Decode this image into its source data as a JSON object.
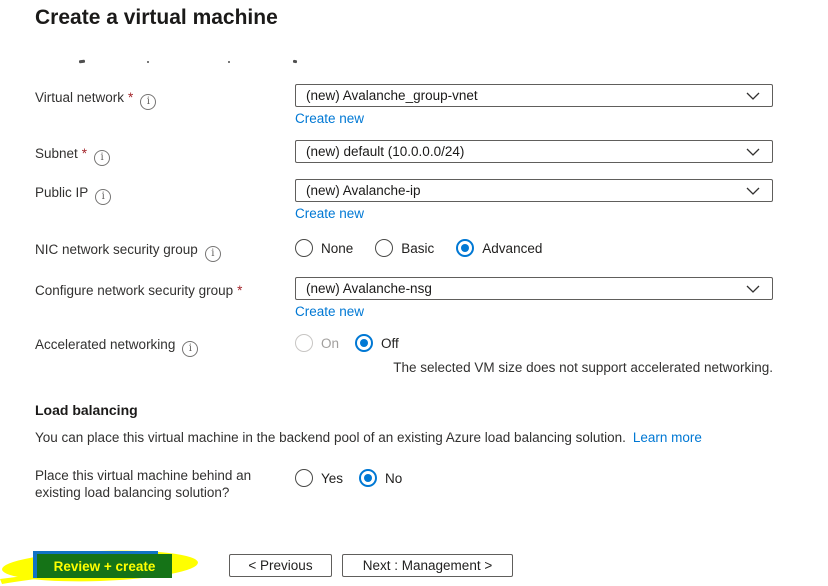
{
  "title": "Create a virtual machine",
  "icons": {
    "info": "i",
    "chevron": "chevron-down"
  },
  "colors": {
    "link": "#0078d4",
    "accent": "#0078d4",
    "required_asterisk": "#a4262c",
    "annotation_yellow": "#ffff00",
    "annotation_green": "#157317",
    "annotation_blue": "#1173c5"
  },
  "fields": {
    "virtual_network": {
      "label": "Virtual network",
      "required": "*",
      "value": "(new) Avalanche_group-vnet",
      "create_new": "Create new"
    },
    "subnet": {
      "label": "Subnet",
      "required": "*",
      "value": "(new) default (10.0.0.0/24)"
    },
    "public_ip": {
      "label": "Public IP",
      "value": "(new) Avalanche-ip",
      "create_new": "Create new"
    },
    "nic_nsg": {
      "label": "NIC network security group",
      "options": [
        "None",
        "Basic",
        "Advanced"
      ],
      "selected": "Advanced"
    },
    "configure_nsg": {
      "label": "Configure network security group",
      "required": "*",
      "value": "(new) Avalanche-nsg",
      "create_new": "Create new"
    },
    "accelerated_networking": {
      "label": "Accelerated networking",
      "options": [
        "On",
        "Off"
      ],
      "selected": "Off",
      "disabled_option": "On",
      "note": "The selected VM size does not support accelerated networking."
    }
  },
  "load_balancing": {
    "heading": "Load balancing",
    "description": "You can place this virtual machine in the backend pool of an existing Azure load balancing solution.",
    "learn_more": "Learn more",
    "question": {
      "line1": "Place this virtual machine behind an",
      "line2": "existing load balancing solution?",
      "options": [
        "Yes",
        "No"
      ],
      "selected": "No"
    }
  },
  "footer": {
    "review_create": "Review + create",
    "previous": "< Previous",
    "next": "Next : Management >"
  }
}
